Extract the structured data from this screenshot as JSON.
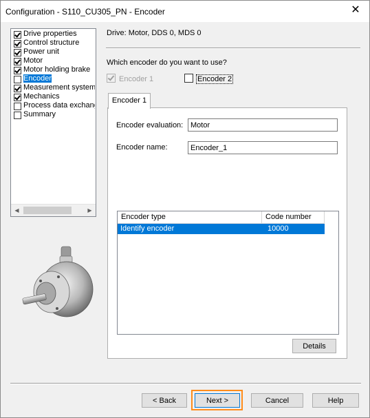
{
  "window": {
    "title": "Configuration - S110_CU305_PN - Encoder",
    "close_glyph": "✕"
  },
  "tree": {
    "items": [
      {
        "label": "Drive properties",
        "checked": true,
        "selected": false
      },
      {
        "label": "Control structure",
        "checked": true,
        "selected": false
      },
      {
        "label": "Power unit",
        "checked": true,
        "selected": false
      },
      {
        "label": "Motor",
        "checked": true,
        "selected": false
      },
      {
        "label": "Motor holding brake",
        "checked": true,
        "selected": false
      },
      {
        "label": "Encoder",
        "checked": false,
        "selected": true
      },
      {
        "label": "Measurement system",
        "checked": true,
        "selected": false
      },
      {
        "label": "Mechanics",
        "checked": true,
        "selected": false
      },
      {
        "label": "Process data exchang",
        "checked": false,
        "selected": false
      },
      {
        "label": "Summary",
        "checked": false,
        "selected": false
      }
    ],
    "scroll_left_glyph": "◀",
    "scroll_right_glyph": "▶"
  },
  "header": {
    "drive_label": "Drive: Motor, DDS 0, MDS 0"
  },
  "encoder_choice": {
    "question": "Which encoder do you want to use?",
    "encoder1_label": "Encoder 1",
    "encoder1_checked": true,
    "encoder2_label": "Encoder 2",
    "encoder2_checked": false
  },
  "tab": {
    "label": "Encoder 1"
  },
  "form": {
    "evaluation_label": "Encoder evaluation:",
    "evaluation_value": "Motor",
    "name_label": "Encoder name:",
    "name_value": "Encoder_1"
  },
  "table": {
    "columns": [
      "Encoder type",
      "Code number"
    ],
    "rows": [
      {
        "type": "Identify encoder",
        "code": "10000"
      }
    ]
  },
  "buttons": {
    "details": "Details",
    "back": "< Back",
    "next": "Next >",
    "cancel": "Cancel",
    "help": "Help"
  },
  "colors": {
    "selection": "#0078d7",
    "highlight": "#ff8c1a"
  }
}
